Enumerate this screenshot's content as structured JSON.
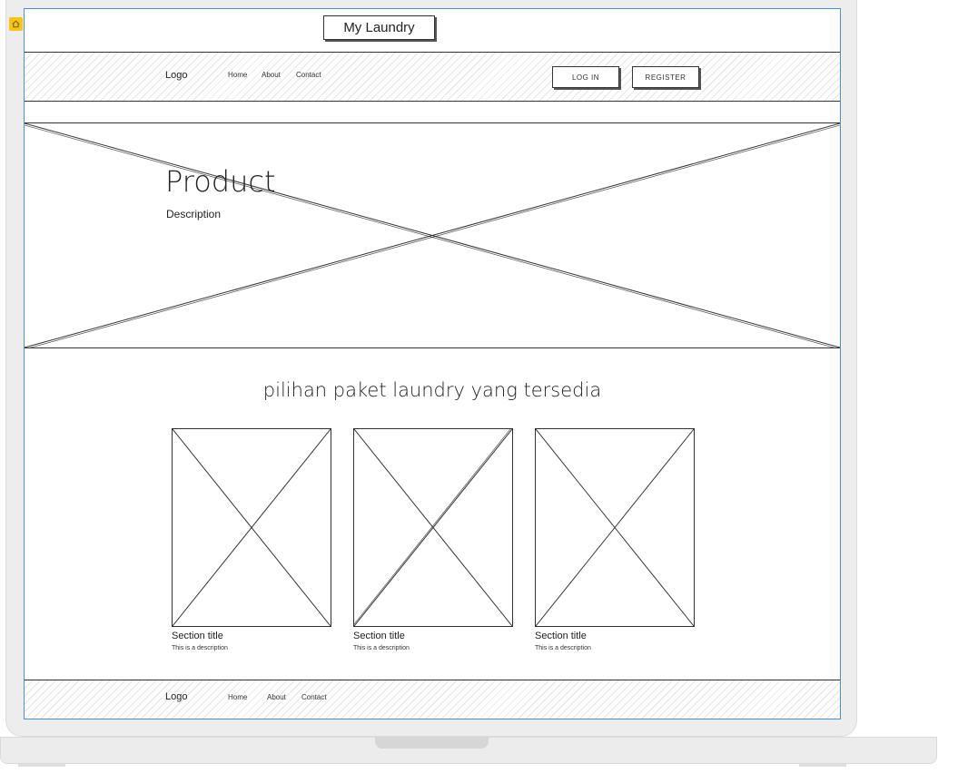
{
  "app": {
    "title": "My Laundry"
  },
  "header": {
    "logo": "Logo",
    "nav": [
      {
        "label": "Home"
      },
      {
        "label": "About"
      },
      {
        "label": "Contact"
      }
    ],
    "login_label": "LOG IN",
    "register_label": "REGISTER"
  },
  "hero": {
    "title": "Product",
    "description": "Description"
  },
  "packages": {
    "heading": "pilihan paket laundry yang tersedia",
    "cards": [
      {
        "title": "Section title",
        "description": "This is a description"
      },
      {
        "title": "Section title",
        "description": "This is a description"
      },
      {
        "title": "Section title",
        "description": "This is a description"
      }
    ]
  },
  "footer": {
    "logo": "Logo",
    "nav": [
      {
        "label": "Home"
      },
      {
        "label": "About"
      },
      {
        "label": "Contact"
      }
    ]
  },
  "colors": {
    "selection_border": "#4a90e2",
    "badge": "#f5c518",
    "stroke": "#333333"
  }
}
